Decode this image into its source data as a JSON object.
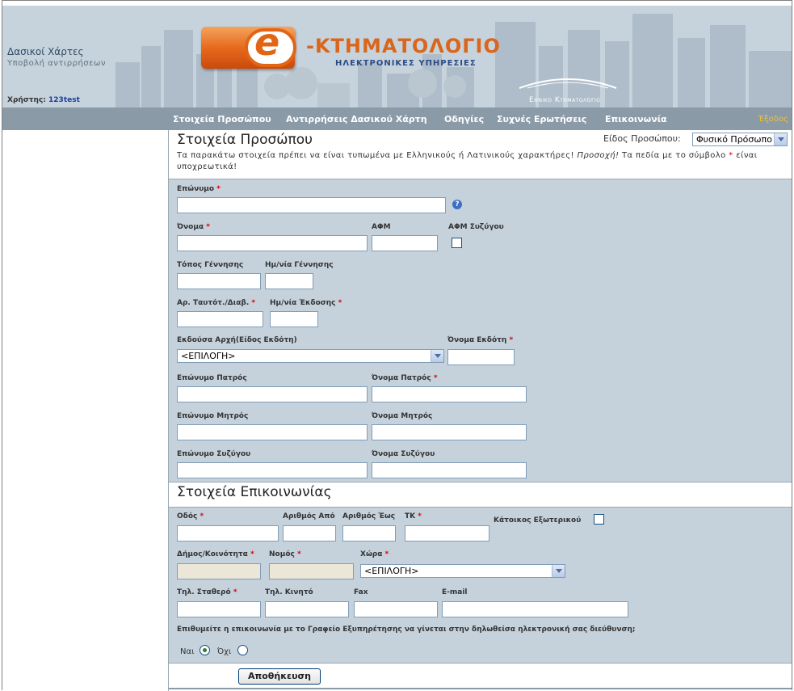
{
  "header": {
    "section_title": "Δασικοί Χάρτες",
    "section_sub": "Υποβολή αντιρρήσεων",
    "user_label": "Χρήστης:",
    "user_name": "123test",
    "logo_letter": "e",
    "logo_title": "-ΚΤΗΜΑΤΟΛΟΓΙΟ",
    "logo_subtitle": "ΗΛΕΚΤΡΟΝΙΚΕΣ ΥΠΗΡΕΣΙΕΣ",
    "brand": "Εθνικό Κτηματολόγιο"
  },
  "nav": {
    "items": [
      "Στοιχεία Προσώπου",
      "Αντιρρήσεις Δασικού Χάρτη",
      "Οδηγίες",
      "Συχνές Ερωτήσεις",
      "Επικοινωνία"
    ],
    "exit": "Έξοδος"
  },
  "person": {
    "title": "Στοιχεία Προσώπου",
    "type_label": "Είδος Προσώπου:",
    "type_value": "Φυσικό Πρόσωπο",
    "intro_1": "Τα παρακάτω στοιχεία πρέπει να είναι τυπωμένα με Ελληνικούς ή Λατινικούς χαρακτήρες!",
    "intro_caution": "Προσοχή!",
    "intro_2": "Τα πεδία με το σύμβολο",
    "intro_star": "*",
    "intro_3": "είναι υποχρεωτικά!",
    "fields": {
      "surname": "Επώνυμο",
      "name": "Όνομα",
      "afm": "ΑΦΜ",
      "afm_spouse": "ΑΦΜ Συζύγου",
      "birth_place": "Τόπος Γέννησης",
      "birth_date": "Ημ/νία Γέννησης",
      "id_number": "Αρ. Ταυτότ./Διαβ.",
      "issue_date": "Ημ/νία Έκδοσης",
      "issuing_authority": "Εκδούσα Αρχή(Είδος Εκδότη)",
      "issuing_authority_value": "<ΕΠΙΛΟΓΗ>",
      "issuer_name": "Όνομα Εκδότη",
      "father_surname": "Επώνυμο Πατρός",
      "father_name": "Όνομα Πατρός",
      "mother_surname": "Επώνυμο Μητρός",
      "mother_name": "Όνομα Μητρός",
      "spouse_surname": "Επώνυμο Συζύγου",
      "spouse_name": "Όνομα Συζύγου"
    },
    "required_mark": "*",
    "help_icon": "?"
  },
  "contact": {
    "title": "Στοιχεία Επικοινωνίας",
    "fields": {
      "street": "Οδός",
      "number_from": "Αριθμός Από",
      "number_to": "Αριθμός Έως",
      "zip": "ΤΚ",
      "abroad": "Κάτοικος Εξωτερικού",
      "municipality": "Δήμος/Κοινότητα",
      "prefecture": "Νομός",
      "country": "Χώρα",
      "country_value": "<ΕΠΙΛΟΓΗ>",
      "phone": "Τηλ. Σταθερό",
      "mobile": "Τηλ. Κινητό",
      "fax": "Fax",
      "email": "E-mail"
    },
    "email_question": "Επιθυμείτε η επικοινωνία με το Γραφείο Εξυπηρέτησης να γίνεται στην δηλωθείσα ηλεκτρονική σας διεύθυνση;",
    "yes": "Ναι",
    "no": "Όχι"
  },
  "save_button": "Αποθήκευση"
}
